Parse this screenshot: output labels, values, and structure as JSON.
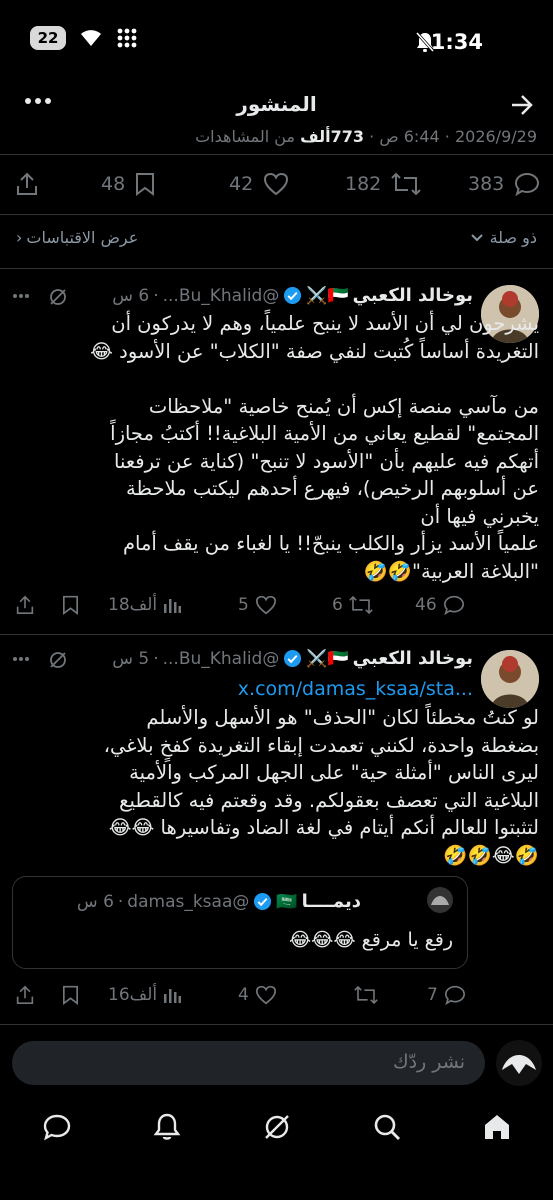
{
  "status": {
    "time": "1:34",
    "battery_level": "22"
  },
  "header": {
    "title": "المنشور",
    "meta_date": "2026/9/29",
    "meta_time": "6:44 ص",
    "meta_views_count": "773ألف",
    "meta_views_label": "من المشاهدات"
  },
  "main_post_stats": {
    "replies": "383",
    "reposts": "182",
    "likes": "42",
    "bookmarks": "48"
  },
  "reply_bar": {
    "who_can_reply": "ذو صلة",
    "view_quotes": "عرض الاقتباسات"
  },
  "tweets": [
    {
      "name": "بوخالد الكعبي",
      "name_emoji": "🇦🇪⚔️",
      "handle": "@Bu_Khalid...",
      "time": "6 س",
      "text": "يشرحون لي أن الأسد لا ينبح علمياً، وهم لا يدركون أن التغريدة أساساً كُتبت لنفي صفة \"الكلاب\" عن الأسود 😂\n\nمن مآسي منصة إكس أن يُمنح خاصية \"ملاحظات المجتمع\" لقطيع يعاني من الأمية البلاغية!! أكتبُ مجازاً أتهكم فيه عليهم بأن \"الأسود لا تنبح\" (كناية عن ترفعنا عن أسلوبهم الرخيص)، فيهرع أحدهم ليكتب ملاحظة يخبرني فيها أن\nعلمياً الأسد يزأر والكلب ينبحّ!! يا لغباء من يقف أمام \"البلاغة العربية\"🤣🤣",
      "replies": "46",
      "reposts": "6",
      "likes": "5",
      "views": "18ألف"
    },
    {
      "name": "بوخالد الكعبي",
      "name_emoji": "🇦🇪⚔️",
      "handle": "@Bu_Khalid...",
      "time": "5 س",
      "link": "x.com/damas_ksaa/sta...",
      "text": "لو كنتُ مخطئاً لكان \"الحذف\" هو الأسهل والأسلم بضغطة واحدة، لكنني تعمدت إبقاء التغريدة كفخٍ بلاغي، ليرى الناس \"أمثلة حية\" على الجهل المركب والأمية البلاغية التي تعصف بعقولكم. وقد وقعتم فيه كالقطيع لتثبتوا للعالم أنكم أيتام في لغة الضاد وتفاسيرها 😂😂\n🤣😂🤣🤣",
      "quote": {
        "name": "ديمــــا",
        "name_emoji": "🇸🇦",
        "handle": "@damas_ksaa",
        "time": "6 س",
        "text": "رقع يا مرقع 😂😂😂"
      },
      "replies": "7",
      "reposts": "",
      "likes": "4",
      "views": "16ألف"
    }
  ],
  "composer": {
    "placeholder": "نشر ردّك"
  },
  "colors": {
    "background": "#000000",
    "text": "#e7e9ea",
    "muted": "#71767b",
    "accent": "#1d9bf0",
    "divider": "#2f3336"
  },
  "icons": {
    "nav_back": "arrow-right-icon",
    "nav_more": "more-horizontal-icon",
    "tab_home": "home-icon",
    "tab_search": "search-icon",
    "tab_grok": "grok-icon",
    "tab_notifications": "bell-icon",
    "tab_messages": "message-icon"
  }
}
